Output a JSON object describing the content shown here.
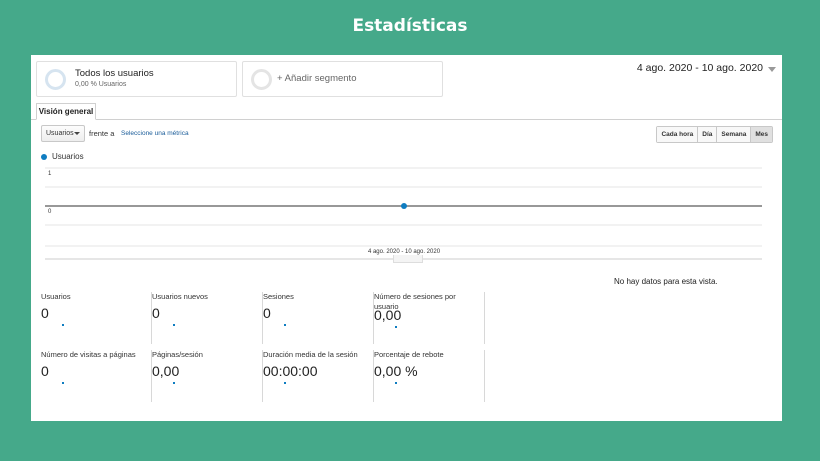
{
  "page_title": "Estadísticas",
  "segments": [
    {
      "title": "Todos los usuarios",
      "subtitle": "0,00 % Usuarios"
    },
    {
      "title": "+ Añadir segmento"
    }
  ],
  "date_range": "4 ago. 2020 - 10 ago. 2020",
  "tab": "Visión general",
  "controls": {
    "metric": "Usuarios",
    "vs_label": "frente a",
    "select_metric": "Seleccione una métrica",
    "granularity": [
      "Cada hora",
      "Día",
      "Semana",
      "Mes"
    ],
    "active_granularity": "Mes"
  },
  "chart_data": {
    "type": "line",
    "series": [
      {
        "name": "Usuarios",
        "values": [
          0
        ]
      }
    ],
    "categories": [
      "4 ago. 2020 - 10 ago. 2020"
    ],
    "yticks": [
      "1",
      "0"
    ],
    "ylim": [
      0,
      1
    ],
    "grid": true,
    "color": "#0f7dc1"
  },
  "no_data_text": "No hay datos para esta vista.",
  "metrics": [
    {
      "label": "Usuarios",
      "value": "0"
    },
    {
      "label": "Usuarios nuevos",
      "value": "0"
    },
    {
      "label": "Sesiones",
      "value": "0"
    },
    {
      "label": "Número de sesiones por usuario",
      "value": "0,00"
    },
    {
      "label": "Número de visitas a páginas",
      "value": "0"
    },
    {
      "label": "Páginas/sesión",
      "value": "0,00"
    },
    {
      "label": "Duración media de la sesión",
      "value": "00:00:00"
    },
    {
      "label": "Porcentaje de rebote",
      "value": "0,00 %"
    }
  ]
}
